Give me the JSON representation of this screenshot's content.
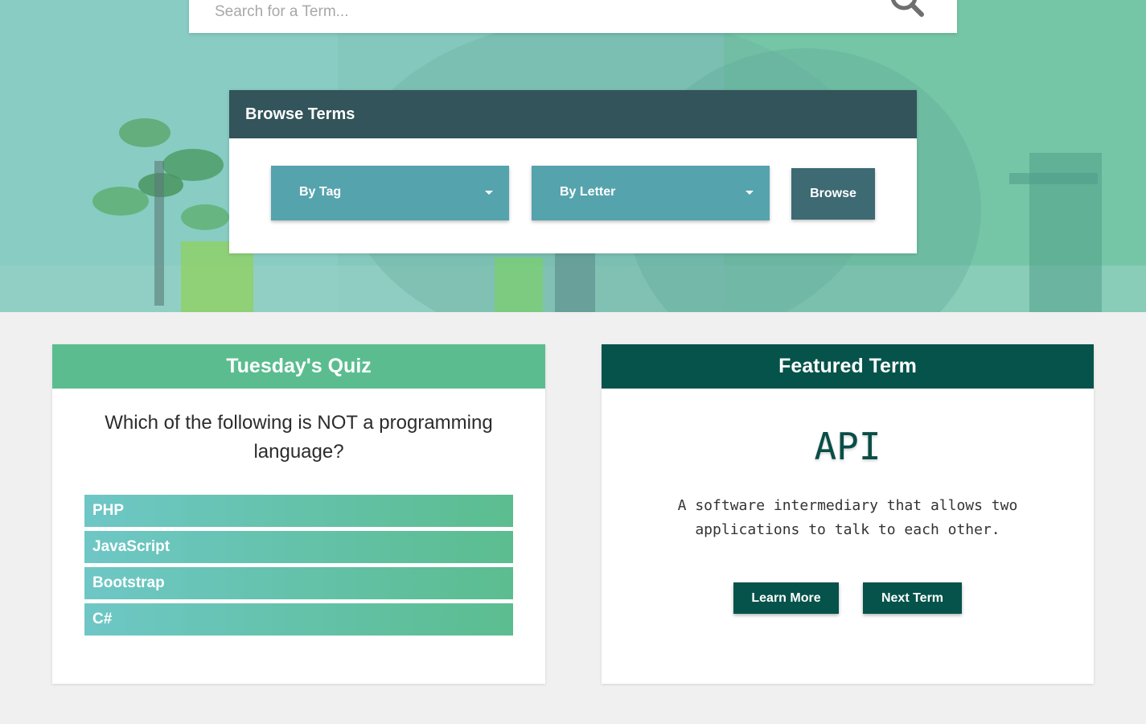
{
  "search": {
    "placeholder": "Search for a Term..."
  },
  "browse": {
    "title": "Browse Terms",
    "tag_dropdown": "By Tag",
    "letter_dropdown": "By Letter",
    "button": "Browse"
  },
  "quiz": {
    "title": "Tuesday's Quiz",
    "question": "Which of the following is NOT a programming language?",
    "options": [
      "PHP",
      "JavaScript",
      "Bootstrap",
      "C#"
    ]
  },
  "featured": {
    "title": "Featured Term",
    "term": "API",
    "definition": "A software intermediary that allows two applications to talk to each other.",
    "learn_more": "Learn More",
    "next_term": "Next Term"
  },
  "colors": {
    "browse_header": "#32545a",
    "dropdown": "#55a3ad",
    "browse_button": "#3d6a73",
    "quiz_header": "#5bbd8f",
    "featured_header": "#05534a"
  },
  "icons": {
    "search": "magnifying-glass"
  }
}
